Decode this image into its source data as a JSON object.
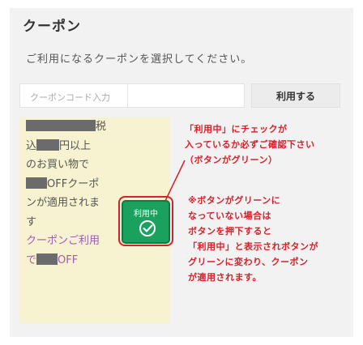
{
  "page": {
    "title": "クーポン",
    "description": "ご利用になるクーポンを選択してください。"
  },
  "coupon_input": {
    "placeholder": "クーポンコード入力",
    "apply_label": "利用する"
  },
  "coupon_card": {
    "lines": [
      {
        "text": "税",
        "redacted_before": true
      },
      {
        "text": "込",
        "redacted_mid": true,
        "after": "円以上"
      },
      {
        "text": "のお買い物で"
      },
      {
        "text": "OFFクーポ",
        "redacted_before": true
      },
      {
        "text": "ンが適用されま"
      },
      {
        "text": "す"
      },
      {
        "text": "クーポンご利用",
        "accent": true
      },
      {
        "text": "で",
        "after": "OFF",
        "accent": true
      }
    ],
    "use_button_label": "利用中",
    "accent_color": "#a05bb0",
    "button_color": "#1aa15d"
  },
  "annotations": {
    "top": [
      "「利用中」にチェックが",
      "入っているか必ずご確認下さい",
      "（ボタンがグリーン）"
    ],
    "bottom": [
      "※ボタンがグリーンに",
      "なっていない場合は",
      "ボタンを押下すると",
      "「利用中」と表示されボタンが",
      "グリーンに変わり、クーポン",
      "が適用されます。"
    ],
    "color": "#d8202a"
  }
}
